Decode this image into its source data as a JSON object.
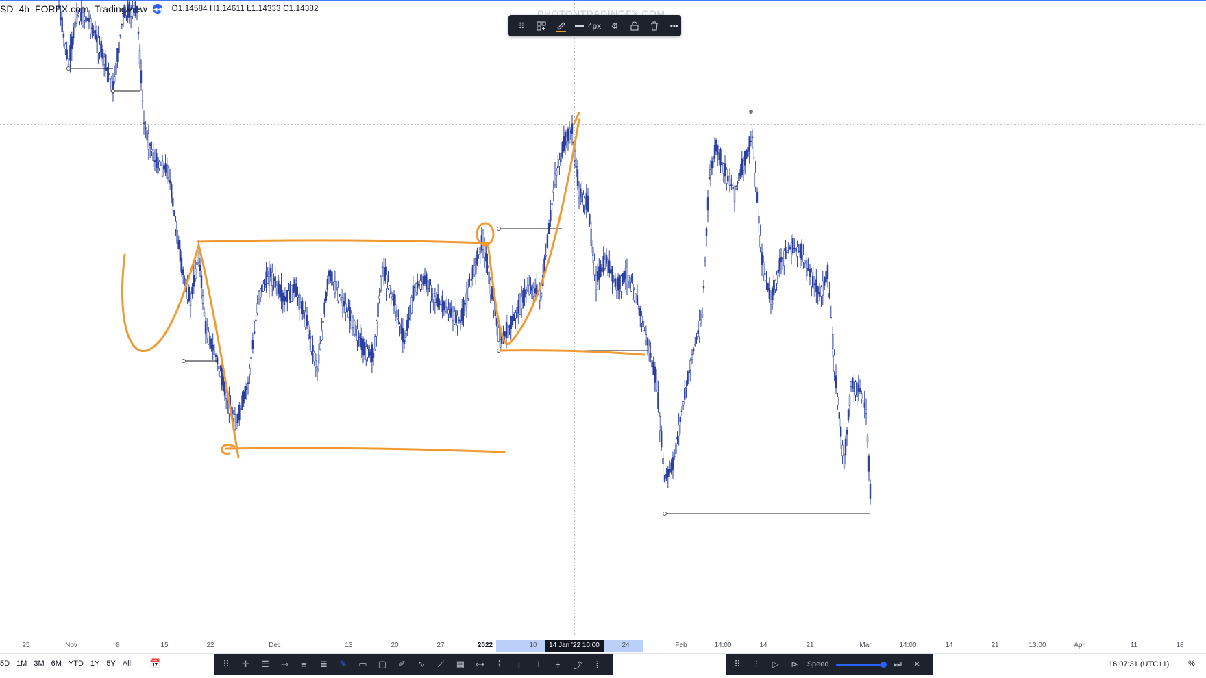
{
  "header": {
    "symbol": "SD",
    "interval": "4h",
    "source": "FOREX.com",
    "platform": "TradingView",
    "ohlc": "O1.14584 H1.14611 L1.14333 C1.14382"
  },
  "watermark": "PHOTONTRADINGFX.COM",
  "drawing_toolbar": {
    "width_label": "4px",
    "icons": [
      "drag-handle-icon",
      "template-icon",
      "pencil-color-icon",
      "line-width-icon",
      "settings-icon",
      "lock-icon",
      "trash-icon",
      "more-icon"
    ],
    "accent_color": "#f09a33"
  },
  "time_axis": {
    "ticks": [
      "25",
      "Nov",
      "8",
      "15",
      "22",
      "Dec",
      "13",
      "20",
      "27",
      "2022",
      "10",
      "24",
      "Feb",
      "14:00",
      "14",
      "21",
      "Mar",
      "14:00",
      "14",
      "21",
      "13:00",
      "Apr",
      "11",
      "18"
    ],
    "cursor_label": "14 Jan '22  10:00"
  },
  "bottom": {
    "ranges": [
      "5D",
      "1M",
      "3M",
      "6M",
      "YTD",
      "1Y",
      "5Y",
      "All"
    ],
    "speed_label": "Speed",
    "clock": "16:07:31 (UTC+1)",
    "percent": "%"
  },
  "colors": {
    "candle": "#2a3fa0",
    "drawing": "#f09a33",
    "level_line": "#131722",
    "crosshair": "#787b86"
  }
}
